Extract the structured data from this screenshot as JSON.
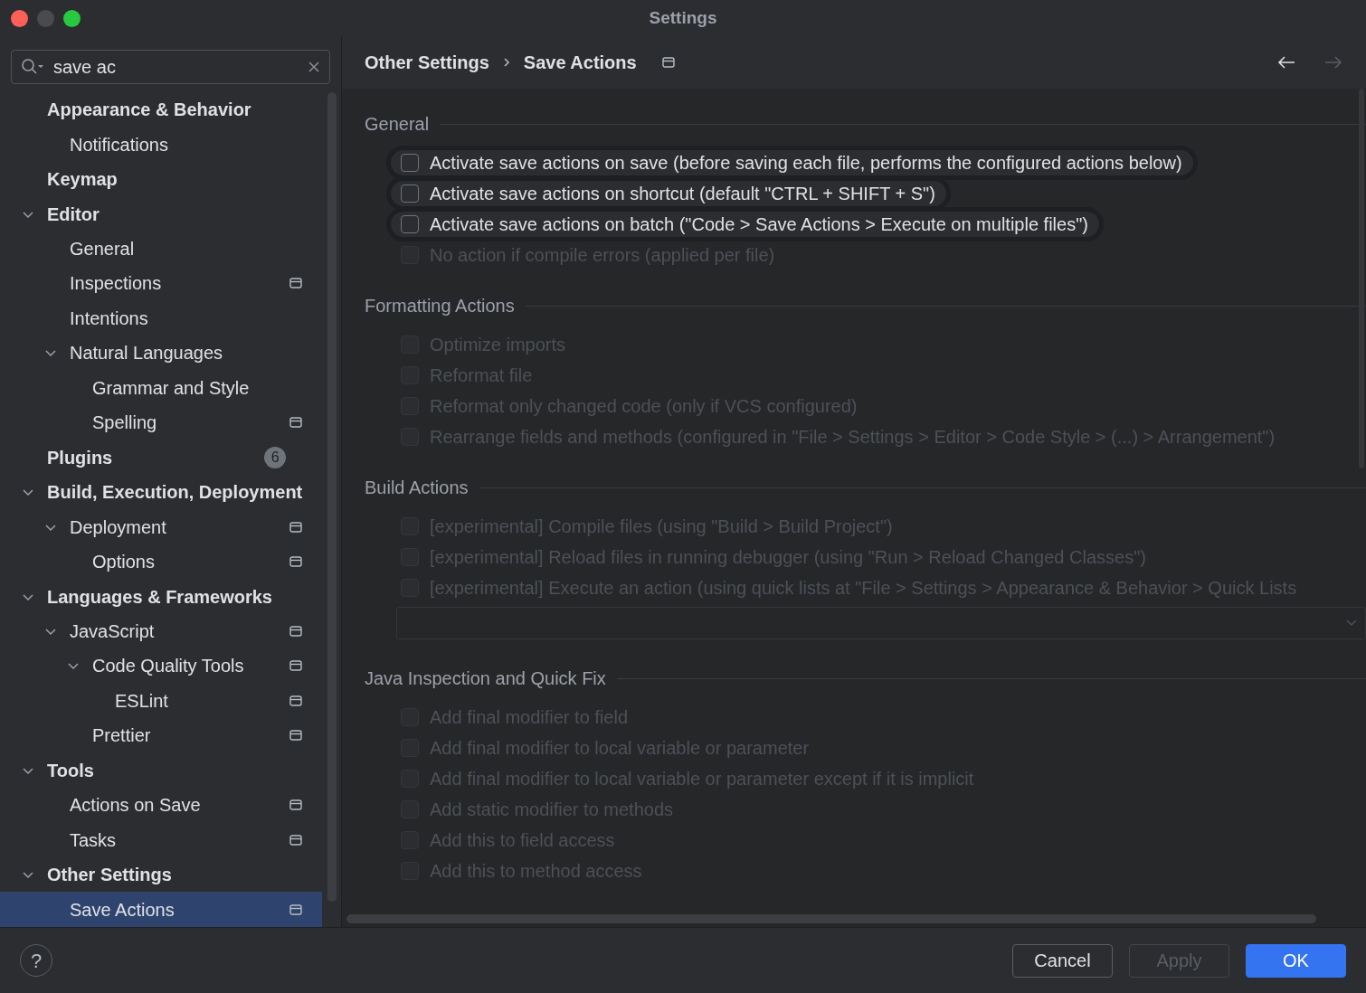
{
  "window": {
    "title": "Settings"
  },
  "search": {
    "value": "save ac"
  },
  "sidebar": {
    "items": [
      {
        "label": "Appearance & Behavior",
        "project_icon": false,
        "selected": false,
        "children": [
          {
            "label": "Notifications",
            "project_icon": false,
            "selected": false
          }
        ]
      },
      {
        "label": "Keymap",
        "project_icon": false,
        "selected": false
      },
      {
        "label": "Editor",
        "expanded": true,
        "project_icon": false,
        "selected": false,
        "children": [
          {
            "label": "General",
            "project_icon": false,
            "selected": false
          },
          {
            "label": "Inspections",
            "project_icon": true,
            "selected": false
          },
          {
            "label": "Intentions",
            "project_icon": false,
            "selected": false
          },
          {
            "label": "Natural Languages",
            "expanded": true,
            "project_icon": false,
            "selected": false,
            "children": [
              {
                "label": "Grammar and Style",
                "project_icon": false,
                "selected": false
              },
              {
                "label": "Spelling",
                "project_icon": true,
                "selected": false
              }
            ]
          }
        ]
      },
      {
        "label": "Plugins",
        "badge": "6",
        "project_icon": false,
        "selected": false
      },
      {
        "label": "Build, Execution, Deployment",
        "expanded": true,
        "project_icon": false,
        "selected": false,
        "children": [
          {
            "label": "Deployment",
            "expanded": true,
            "project_icon": true,
            "selected": false,
            "children": [
              {
                "label": "Options",
                "project_icon": true,
                "selected": false
              }
            ]
          }
        ]
      },
      {
        "label": "Languages & Frameworks",
        "expanded": true,
        "project_icon": false,
        "selected": false,
        "children": [
          {
            "label": "JavaScript",
            "expanded": true,
            "project_icon": true,
            "selected": false,
            "children": [
              {
                "label": "Code Quality Tools",
                "expanded": true,
                "project_icon": true,
                "selected": false,
                "children": [
                  {
                    "label": "ESLint",
                    "project_icon": true,
                    "selected": false
                  }
                ]
              },
              {
                "label": "Prettier",
                "project_icon": true,
                "selected": false
              }
            ]
          }
        ]
      },
      {
        "label": "Tools",
        "expanded": true,
        "project_icon": false,
        "selected": false,
        "children": [
          {
            "label": "Actions on Save",
            "project_icon": true,
            "selected": false
          },
          {
            "label": "Tasks",
            "project_icon": true,
            "selected": false
          }
        ]
      },
      {
        "label": "Other Settings",
        "expanded": true,
        "project_icon": false,
        "selected": false,
        "children": [
          {
            "label": "Save Actions",
            "project_icon": true,
            "selected": true
          }
        ]
      }
    ]
  },
  "breadcrumb": [
    "Other Settings",
    "Save Actions"
  ],
  "sections": [
    {
      "title": "General",
      "options": [
        {
          "kind": "checkbox",
          "label": "Activate save actions on save (before saving each file, performs the configured actions below)",
          "checked": false,
          "disabled": false,
          "highlighted": true
        },
        {
          "kind": "checkbox",
          "label": "Activate save actions on shortcut (default \"CTRL + SHIFT + S\")",
          "checked": false,
          "disabled": false,
          "highlighted": true
        },
        {
          "kind": "checkbox",
          "label": "Activate save actions on batch (\"Code > Save Actions > Execute on multiple files\")",
          "checked": false,
          "disabled": false,
          "highlighted": true
        },
        {
          "kind": "checkbox",
          "label": "No action if compile errors (applied per file)",
          "checked": false,
          "disabled": true,
          "highlighted": false
        }
      ]
    },
    {
      "title": "Formatting Actions",
      "options": [
        {
          "kind": "checkbox",
          "label": "Optimize imports",
          "checked": false,
          "disabled": true,
          "highlighted": false
        },
        {
          "kind": "checkbox",
          "label": "Reformat file",
          "checked": false,
          "disabled": true,
          "highlighted": false
        },
        {
          "kind": "checkbox",
          "label": "Reformat only changed code (only if VCS configured)",
          "checked": false,
          "disabled": true,
          "highlighted": false
        },
        {
          "kind": "checkbox",
          "label": "Rearrange fields and methods (configured in \"File > Settings > Editor > Code Style > (...) > Arrangement\")",
          "checked": false,
          "disabled": true,
          "highlighted": false
        }
      ]
    },
    {
      "title": "Build Actions",
      "options": [
        {
          "kind": "checkbox",
          "label": "[experimental] Compile files (using \"Build > Build Project\")",
          "checked": false,
          "disabled": true,
          "highlighted": false
        },
        {
          "kind": "checkbox",
          "label": "[experimental] Reload files in running debugger (using \"Run > Reload Changed Classes\")",
          "checked": false,
          "disabled": true,
          "highlighted": false
        },
        {
          "kind": "checkbox",
          "label": "[experimental] Execute an action (using quick lists at \"File > Settings > Appearance & Behavior > Quick Lists",
          "checked": false,
          "disabled": true,
          "highlighted": false
        },
        {
          "kind": "dropdown",
          "disabled": true
        }
      ]
    },
    {
      "title": "Java Inspection and Quick Fix",
      "options": [
        {
          "kind": "checkbox",
          "label": "Add final modifier to field",
          "checked": false,
          "disabled": true,
          "highlighted": false
        },
        {
          "kind": "checkbox",
          "label": "Add final modifier to local variable or parameter",
          "checked": false,
          "disabled": true,
          "highlighted": false
        },
        {
          "kind": "checkbox",
          "label": "Add final modifier to local variable or parameter except if it is implicit",
          "checked": false,
          "disabled": true,
          "highlighted": false
        },
        {
          "kind": "checkbox",
          "label": "Add static modifier to methods",
          "checked": false,
          "disabled": true,
          "highlighted": false
        },
        {
          "kind": "checkbox",
          "label": "Add this to field access",
          "checked": false,
          "disabled": true,
          "highlighted": false
        },
        {
          "kind": "checkbox",
          "label": "Add this to method access",
          "checked": false,
          "disabled": true,
          "highlighted": false
        }
      ]
    }
  ],
  "help": {
    "label": "?"
  },
  "buttons": [
    {
      "label": "Cancel",
      "kind": "secondary",
      "disabled": false
    },
    {
      "label": "Apply",
      "kind": "secondary",
      "disabled": true
    },
    {
      "label": "OK",
      "kind": "primary",
      "disabled": false
    }
  ]
}
